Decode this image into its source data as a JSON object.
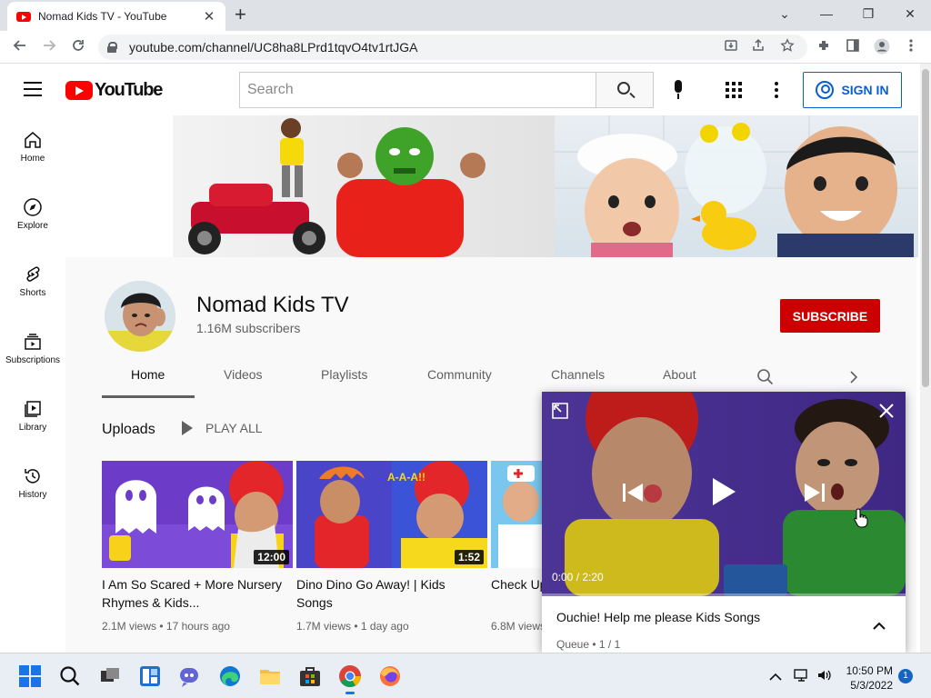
{
  "browser": {
    "tab_title": "Nomad Kids TV - YouTube",
    "tab_close": "✕",
    "new_tab": "+",
    "url": "youtube.com/channel/UC8ha8LPrd1tqvO4tv1rtJGA",
    "window_controls": {
      "dropdown": "⌄",
      "minimize": "—",
      "restore": "❐",
      "close": "✕"
    },
    "icons": [
      "back-arrow-icon",
      "forward-arrow-icon",
      "reload-icon",
      "lock-icon",
      "install-icon",
      "share-icon",
      "star-icon",
      "extensions-icon",
      "side-panel-icon",
      "profile-icon",
      "menu-icon"
    ]
  },
  "masthead": {
    "logo_text": "YouTube",
    "search_placeholder": "Search",
    "sign_in": "SIGN IN"
  },
  "guide": [
    {
      "label": "Home",
      "icon": "home-icon"
    },
    {
      "label": "Explore",
      "icon": "compass-icon"
    },
    {
      "label": "Shorts",
      "icon": "shorts-icon"
    },
    {
      "label": "Subscriptions",
      "icon": "subscriptions-icon"
    },
    {
      "label": "Library",
      "icon": "library-icon"
    },
    {
      "label": "History",
      "icon": "history-icon"
    }
  ],
  "channel": {
    "name": "Nomad Kids TV",
    "subscribers": "1.16M subscribers",
    "subscribe": "SUBSCRIBE",
    "tabs": [
      "Home",
      "Videos",
      "Playlists",
      "Community",
      "Channels",
      "About"
    ],
    "active_tab": "Home"
  },
  "uploads": {
    "title": "Uploads",
    "play_all": "PLAY ALL",
    "videos": [
      {
        "title": "I Am So Scared + More Nursery Rhymes & Kids...",
        "duration": "12:00",
        "views": "2.1M views",
        "age": "17 hours ago"
      },
      {
        "title": "Dino Dino Go Away! | Kids Songs",
        "duration": "1:52",
        "views": "1.7M views",
        "age": "1 day ago"
      },
      {
        "title": "Check Up",
        "duration": "",
        "views": "6.8M views",
        "age": ""
      }
    ],
    "meta_separator": " • "
  },
  "miniplayer": {
    "time": "0:00 / 2:20",
    "progress": 0.0,
    "title": "Ouchie! Help me please Kids Songs",
    "queue": "Queue • 1 / 1"
  },
  "taskbar": {
    "time": "10:50 PM",
    "date": "5/3/2022",
    "notifications": "1"
  },
  "colors": {
    "brand_red": "#ff0000",
    "subscribe_red": "#cc0000",
    "link_blue": "#065fd4"
  }
}
